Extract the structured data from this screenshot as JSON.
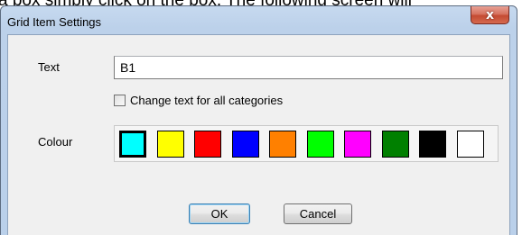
{
  "background": {
    "caption": "a box simply click on the box. The following screen will"
  },
  "dialog": {
    "title": "Grid Item Settings",
    "close_glyph": "x",
    "text_label": "Text",
    "text_value": "B1",
    "checkbox_label": "Change text for all categories",
    "checkbox_checked": false,
    "colour_label": "Colour",
    "colours": [
      {
        "name": "cyan",
        "hex": "#00ffff",
        "selected": true
      },
      {
        "name": "yellow",
        "hex": "#ffff00",
        "selected": false
      },
      {
        "name": "red",
        "hex": "#ff0000",
        "selected": false
      },
      {
        "name": "blue",
        "hex": "#0000ff",
        "selected": false
      },
      {
        "name": "orange",
        "hex": "#ff8000",
        "selected": false
      },
      {
        "name": "green",
        "hex": "#00ff00",
        "selected": false
      },
      {
        "name": "magenta",
        "hex": "#ff00ff",
        "selected": false
      },
      {
        "name": "dark-green",
        "hex": "#008000",
        "selected": false
      },
      {
        "name": "black",
        "hex": "#000000",
        "selected": false
      },
      {
        "name": "white",
        "hex": "#ffffff",
        "selected": false
      }
    ],
    "ok_label": "OK",
    "cancel_label": "Cancel"
  }
}
